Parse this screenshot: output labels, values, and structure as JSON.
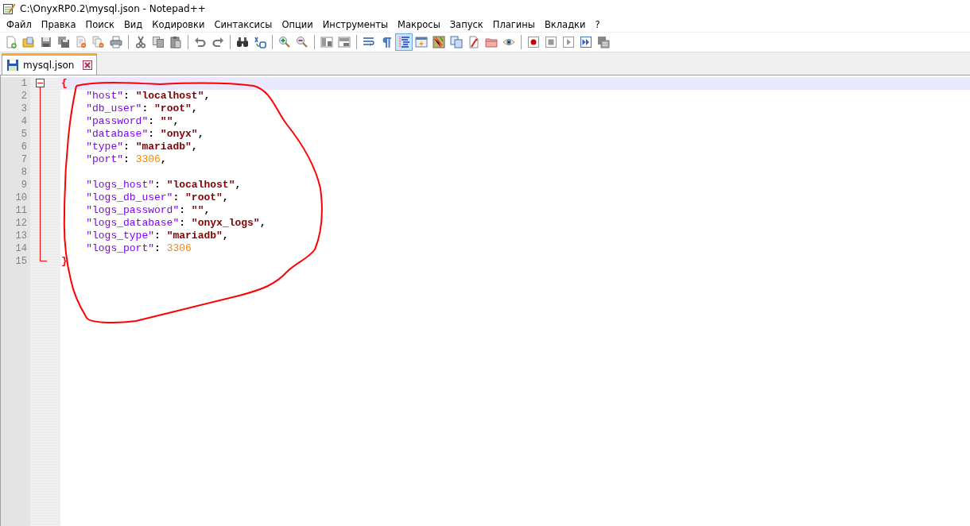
{
  "window": {
    "title": "C:\\OnyxRP0.2\\mysql.json - Notepad++"
  },
  "menu": [
    "Файл",
    "Правка",
    "Поиск",
    "Вид",
    "Кодировки",
    "Синтаксисы",
    "Опции",
    "Инструменты",
    "Макросы",
    "Запуск",
    "Плагины",
    "Вкладки",
    "?"
  ],
  "toolbar": [
    {
      "kind": "new",
      "on": false
    },
    {
      "kind": "open",
      "on": false
    },
    {
      "kind": "save",
      "on": false
    },
    {
      "kind": "saveall",
      "on": false
    },
    {
      "kind": "close",
      "on": false
    },
    {
      "kind": "closeall",
      "on": false
    },
    {
      "kind": "print",
      "on": false
    },
    {
      "kind": "separator"
    },
    {
      "kind": "cut",
      "on": false
    },
    {
      "kind": "copy",
      "on": false
    },
    {
      "kind": "paste",
      "on": false
    },
    {
      "kind": "separator"
    },
    {
      "kind": "undo",
      "on": false
    },
    {
      "kind": "redo",
      "on": false
    },
    {
      "kind": "separator"
    },
    {
      "kind": "find",
      "on": false
    },
    {
      "kind": "replace",
      "on": false
    },
    {
      "kind": "separator"
    },
    {
      "kind": "zoomin",
      "on": false
    },
    {
      "kind": "zoomout",
      "on": false
    },
    {
      "kind": "separator"
    },
    {
      "kind": "syncv",
      "on": false
    },
    {
      "kind": "synch",
      "on": false
    },
    {
      "kind": "separator"
    },
    {
      "kind": "wrap",
      "on": false
    },
    {
      "kind": "showall",
      "on": false
    },
    {
      "kind": "indent",
      "on": true
    },
    {
      "kind": "udl",
      "on": false
    },
    {
      "kind": "docmap",
      "on": false
    },
    {
      "kind": "doclist",
      "on": false
    },
    {
      "kind": "funclist",
      "on": false
    },
    {
      "kind": "folder",
      "on": false
    },
    {
      "kind": "monitor",
      "on": false
    },
    {
      "kind": "separator"
    },
    {
      "kind": "record",
      "on": false
    },
    {
      "kind": "stop",
      "on": false
    },
    {
      "kind": "play",
      "on": false
    },
    {
      "kind": "playmulti",
      "on": false
    },
    {
      "kind": "savemacro",
      "on": false
    }
  ],
  "tabs": [
    {
      "label": "mysql.json",
      "selected": true
    }
  ],
  "editor": {
    "fold": {
      "expanded": true
    },
    "lines": [
      {
        "number": "1",
        "current": true,
        "tokens": [
          {
            "kind": "brace",
            "text": "{"
          }
        ]
      },
      {
        "number": "2",
        "current": false,
        "tokens": [
          {
            "kind": "key",
            "text": "    \"host\""
          },
          {
            "kind": "punct",
            "text": ": "
          },
          {
            "kind": "string",
            "text": "\"localhost\""
          },
          {
            "kind": "punct",
            "text": ","
          }
        ]
      },
      {
        "number": "3",
        "current": false,
        "tokens": [
          {
            "kind": "key",
            "text": "    \"db_user\""
          },
          {
            "kind": "punct",
            "text": ": "
          },
          {
            "kind": "string",
            "text": "\"root\""
          },
          {
            "kind": "punct",
            "text": ","
          }
        ]
      },
      {
        "number": "4",
        "current": false,
        "tokens": [
          {
            "kind": "key",
            "text": "    \"password\""
          },
          {
            "kind": "punct",
            "text": ": "
          },
          {
            "kind": "string",
            "text": "\"\""
          },
          {
            "kind": "punct",
            "text": ","
          }
        ]
      },
      {
        "number": "5",
        "current": false,
        "tokens": [
          {
            "kind": "key",
            "text": "    \"database\""
          },
          {
            "kind": "punct",
            "text": ": "
          },
          {
            "kind": "string",
            "text": "\"onyx\""
          },
          {
            "kind": "punct",
            "text": ","
          }
        ]
      },
      {
        "number": "6",
        "current": false,
        "tokens": [
          {
            "kind": "key",
            "text": "    \"type\""
          },
          {
            "kind": "punct",
            "text": ": "
          },
          {
            "kind": "string",
            "text": "\"mariadb\""
          },
          {
            "kind": "punct",
            "text": ","
          }
        ]
      },
      {
        "number": "7",
        "current": false,
        "tokens": [
          {
            "kind": "key",
            "text": "    \"port\""
          },
          {
            "kind": "punct",
            "text": ": "
          },
          {
            "kind": "number",
            "text": "3306"
          },
          {
            "kind": "punct",
            "text": ","
          }
        ]
      },
      {
        "number": "8",
        "current": false
      },
      {
        "number": "9",
        "current": false,
        "tokens": [
          {
            "kind": "key",
            "text": "    \"logs_host\""
          },
          {
            "kind": "punct",
            "text": ": "
          },
          {
            "kind": "string",
            "text": "\"localhost\""
          },
          {
            "kind": "punct",
            "text": ","
          }
        ]
      },
      {
        "number": "10",
        "current": false,
        "tokens": [
          {
            "kind": "key",
            "text": "    \"logs_db_user\""
          },
          {
            "kind": "punct",
            "text": ": "
          },
          {
            "kind": "string",
            "text": "\"root\""
          },
          {
            "kind": "punct",
            "text": ","
          }
        ]
      },
      {
        "number": "11",
        "current": false,
        "tokens": [
          {
            "kind": "key",
            "text": "    \"logs_password\""
          },
          {
            "kind": "punct",
            "text": ": "
          },
          {
            "kind": "string",
            "text": "\"\""
          },
          {
            "kind": "punct",
            "text": ","
          }
        ]
      },
      {
        "number": "12",
        "current": false,
        "tokens": [
          {
            "kind": "key",
            "text": "    \"logs_database\""
          },
          {
            "kind": "punct",
            "text": ": "
          },
          {
            "kind": "string",
            "text": "\"onyx_logs\""
          },
          {
            "kind": "punct",
            "text": ","
          }
        ]
      },
      {
        "number": "13",
        "current": false,
        "tokens": [
          {
            "kind": "key",
            "text": "    \"logs_type\""
          },
          {
            "kind": "punct",
            "text": ": "
          },
          {
            "kind": "string",
            "text": "\"mariadb\""
          },
          {
            "kind": "punct",
            "text": ","
          }
        ]
      },
      {
        "number": "14",
        "current": false,
        "tokens": [
          {
            "kind": "key",
            "text": "    \"logs_port\""
          },
          {
            "kind": "punct",
            "text": ": "
          },
          {
            "kind": "number",
            "text": "3306"
          }
        ]
      },
      {
        "number": "15",
        "current": false,
        "tokens": [
          {
            "kind": "brace",
            "text": "}"
          }
        ]
      }
    ]
  }
}
